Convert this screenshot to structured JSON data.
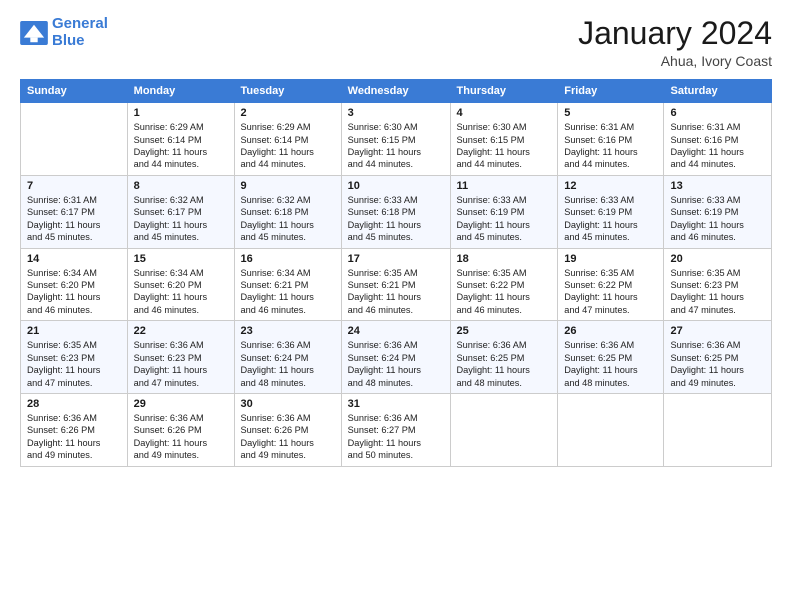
{
  "logo": {
    "line1": "General",
    "line2": "Blue"
  },
  "title": "January 2024",
  "subtitle": "Ahua, Ivory Coast",
  "days_header": [
    "Sunday",
    "Monday",
    "Tuesday",
    "Wednesday",
    "Thursday",
    "Friday",
    "Saturday"
  ],
  "weeks": [
    [
      {
        "num": "",
        "info": ""
      },
      {
        "num": "1",
        "info": "Sunrise: 6:29 AM\nSunset: 6:14 PM\nDaylight: 11 hours\nand 44 minutes."
      },
      {
        "num": "2",
        "info": "Sunrise: 6:29 AM\nSunset: 6:14 PM\nDaylight: 11 hours\nand 44 minutes."
      },
      {
        "num": "3",
        "info": "Sunrise: 6:30 AM\nSunset: 6:15 PM\nDaylight: 11 hours\nand 44 minutes."
      },
      {
        "num": "4",
        "info": "Sunrise: 6:30 AM\nSunset: 6:15 PM\nDaylight: 11 hours\nand 44 minutes."
      },
      {
        "num": "5",
        "info": "Sunrise: 6:31 AM\nSunset: 6:16 PM\nDaylight: 11 hours\nand 44 minutes."
      },
      {
        "num": "6",
        "info": "Sunrise: 6:31 AM\nSunset: 6:16 PM\nDaylight: 11 hours\nand 44 minutes."
      }
    ],
    [
      {
        "num": "7",
        "info": "Sunrise: 6:31 AM\nSunset: 6:17 PM\nDaylight: 11 hours\nand 45 minutes."
      },
      {
        "num": "8",
        "info": "Sunrise: 6:32 AM\nSunset: 6:17 PM\nDaylight: 11 hours\nand 45 minutes."
      },
      {
        "num": "9",
        "info": "Sunrise: 6:32 AM\nSunset: 6:18 PM\nDaylight: 11 hours\nand 45 minutes."
      },
      {
        "num": "10",
        "info": "Sunrise: 6:33 AM\nSunset: 6:18 PM\nDaylight: 11 hours\nand 45 minutes."
      },
      {
        "num": "11",
        "info": "Sunrise: 6:33 AM\nSunset: 6:19 PM\nDaylight: 11 hours\nand 45 minutes."
      },
      {
        "num": "12",
        "info": "Sunrise: 6:33 AM\nSunset: 6:19 PM\nDaylight: 11 hours\nand 45 minutes."
      },
      {
        "num": "13",
        "info": "Sunrise: 6:33 AM\nSunset: 6:19 PM\nDaylight: 11 hours\nand 46 minutes."
      }
    ],
    [
      {
        "num": "14",
        "info": "Sunrise: 6:34 AM\nSunset: 6:20 PM\nDaylight: 11 hours\nand 46 minutes."
      },
      {
        "num": "15",
        "info": "Sunrise: 6:34 AM\nSunset: 6:20 PM\nDaylight: 11 hours\nand 46 minutes."
      },
      {
        "num": "16",
        "info": "Sunrise: 6:34 AM\nSunset: 6:21 PM\nDaylight: 11 hours\nand 46 minutes."
      },
      {
        "num": "17",
        "info": "Sunrise: 6:35 AM\nSunset: 6:21 PM\nDaylight: 11 hours\nand 46 minutes."
      },
      {
        "num": "18",
        "info": "Sunrise: 6:35 AM\nSunset: 6:22 PM\nDaylight: 11 hours\nand 46 minutes."
      },
      {
        "num": "19",
        "info": "Sunrise: 6:35 AM\nSunset: 6:22 PM\nDaylight: 11 hours\nand 47 minutes."
      },
      {
        "num": "20",
        "info": "Sunrise: 6:35 AM\nSunset: 6:23 PM\nDaylight: 11 hours\nand 47 minutes."
      }
    ],
    [
      {
        "num": "21",
        "info": "Sunrise: 6:35 AM\nSunset: 6:23 PM\nDaylight: 11 hours\nand 47 minutes."
      },
      {
        "num": "22",
        "info": "Sunrise: 6:36 AM\nSunset: 6:23 PM\nDaylight: 11 hours\nand 47 minutes."
      },
      {
        "num": "23",
        "info": "Sunrise: 6:36 AM\nSunset: 6:24 PM\nDaylight: 11 hours\nand 48 minutes."
      },
      {
        "num": "24",
        "info": "Sunrise: 6:36 AM\nSunset: 6:24 PM\nDaylight: 11 hours\nand 48 minutes."
      },
      {
        "num": "25",
        "info": "Sunrise: 6:36 AM\nSunset: 6:25 PM\nDaylight: 11 hours\nand 48 minutes."
      },
      {
        "num": "26",
        "info": "Sunrise: 6:36 AM\nSunset: 6:25 PM\nDaylight: 11 hours\nand 48 minutes."
      },
      {
        "num": "27",
        "info": "Sunrise: 6:36 AM\nSunset: 6:25 PM\nDaylight: 11 hours\nand 49 minutes."
      }
    ],
    [
      {
        "num": "28",
        "info": "Sunrise: 6:36 AM\nSunset: 6:26 PM\nDaylight: 11 hours\nand 49 minutes."
      },
      {
        "num": "29",
        "info": "Sunrise: 6:36 AM\nSunset: 6:26 PM\nDaylight: 11 hours\nand 49 minutes."
      },
      {
        "num": "30",
        "info": "Sunrise: 6:36 AM\nSunset: 6:26 PM\nDaylight: 11 hours\nand 49 minutes."
      },
      {
        "num": "31",
        "info": "Sunrise: 6:36 AM\nSunset: 6:27 PM\nDaylight: 11 hours\nand 50 minutes."
      },
      {
        "num": "",
        "info": ""
      },
      {
        "num": "",
        "info": ""
      },
      {
        "num": "",
        "info": ""
      }
    ]
  ]
}
